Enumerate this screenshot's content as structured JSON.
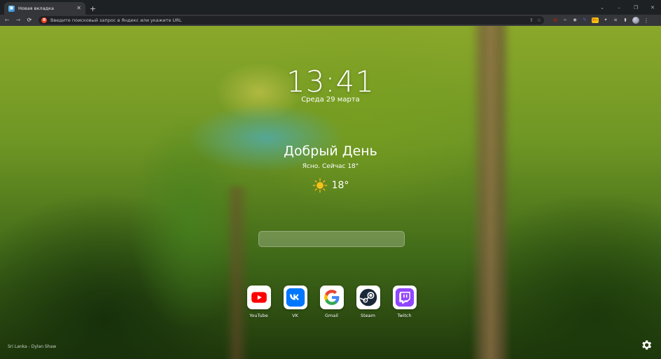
{
  "browser": {
    "tab_title": "Новая вкладка",
    "tab_close": "✕",
    "new_tab": "+",
    "window_controls": [
      "⌄",
      "–",
      "❐",
      "✕"
    ],
    "nav": {
      "back": "←",
      "forward": "→",
      "reload": "⟳"
    },
    "omnibox_placeholder": "Введите поисковый запрос в Яндекс или укажите URL",
    "search_engine_badge": "Я",
    "share_icon": "⇪",
    "star_icon": "☆",
    "extensions": [
      {
        "name": "ext-dark-icon",
        "glyph": "■",
        "color": "#7a2a1a"
      },
      {
        "name": "ext-link-icon",
        "glyph": "∞",
        "color": "#9aa0a6"
      },
      {
        "name": "ext-disc-icon",
        "glyph": "◉",
        "color": "#c8c9cc"
      },
      {
        "name": "ext-pen-icon",
        "glyph": "✎",
        "color": "#7a5cff"
      },
      {
        "name": "ext-adblock-icon",
        "glyph": "99+",
        "color": "#d93025"
      },
      {
        "name": "puzzle-icon",
        "glyph": "✦",
        "color": "#c8c9cc"
      },
      {
        "name": "reading-list-icon",
        "glyph": "≡",
        "color": "#c8c9cc"
      },
      {
        "name": "side-panel-icon",
        "glyph": "▮",
        "color": "#c8c9cc"
      }
    ],
    "menu": "⋮"
  },
  "clock": {
    "time": "13:41",
    "date": "Среда 29 марта"
  },
  "weather": {
    "greeting": "Добрый День",
    "description": "Ясно. Сейчас 18°",
    "temperature": "18°",
    "icon": "sun-icon"
  },
  "search": {
    "placeholder": ""
  },
  "shortcuts": [
    {
      "label": "YouTube",
      "icon": "youtube-icon",
      "color": "#ff0000"
    },
    {
      "label": "VK",
      "icon": "vk-icon",
      "color": "#0077ff"
    },
    {
      "label": "Gmail",
      "icon": "google-icon",
      "color": "#4285f4"
    },
    {
      "label": "Steam",
      "icon": "steam-icon",
      "color": "#1b2838"
    },
    {
      "label": "Twitch",
      "icon": "twitch-icon",
      "color": "#9146ff"
    }
  ],
  "credit": "Sri Lanka - Dylan Shaw",
  "settings_icon": "gear-icon"
}
